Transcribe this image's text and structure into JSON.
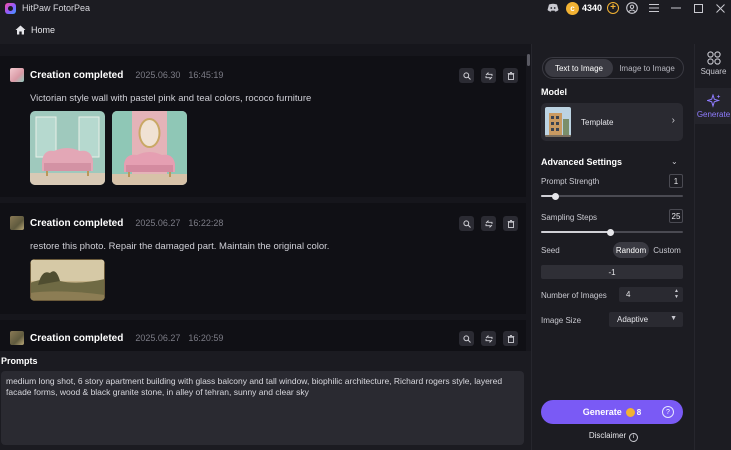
{
  "app": {
    "title": "HitPaw FotorPea"
  },
  "titlebar": {
    "coins": "4340",
    "coin_symbol": "c"
  },
  "home": {
    "label": "Home"
  },
  "feed": {
    "items": [
      {
        "title": "Creation completed",
        "date": "2025.06.30",
        "time": "16:45:19",
        "prompt": "Victorian style wall with pastel pink and teal colors, rococo furniture"
      },
      {
        "title": "Creation completed",
        "date": "2025.06.27",
        "time": "16:22:28",
        "prompt": "restore this photo. Repair the damaged part. Maintain the original color."
      },
      {
        "title": "Creation completed",
        "date": "2025.06.27",
        "time": "16:20:59"
      }
    ]
  },
  "prompts": {
    "label": "Prompts",
    "value": "medium long shot, 6 story apartment building with glass balcony and tall window, biophilic architecture, Richard rogers style, layered facade forms, wood & black granite stone, in alley of tehran, sunny and clear sky"
  },
  "panel": {
    "tabs": [
      "Text to Image",
      "Image to Image"
    ],
    "active_tab": "Text to Image",
    "model": {
      "heading": "Model",
      "name": "Template"
    },
    "advanced": {
      "heading": "Advanced Settings"
    },
    "prompt_strength": {
      "label": "Prompt Strength",
      "value": "1",
      "fraction": 0.1
    },
    "sampling_steps": {
      "label": "Sampling Steps",
      "value": "25",
      "fraction": 0.49
    },
    "seed": {
      "label": "Seed",
      "options": [
        "Random",
        "Custom"
      ],
      "selected": "Random",
      "value": "-1"
    },
    "num_images": {
      "label": "Number of Images",
      "value": "4"
    },
    "image_size": {
      "label": "Image Size",
      "value": "Adaptive"
    },
    "generate": {
      "label": "Generate",
      "cost": "8"
    },
    "disclaimer": "Disclaimer"
  },
  "nav": {
    "items": [
      {
        "label": "Square",
        "icon": "square-grid-icon"
      },
      {
        "label": "Generate",
        "icon": "sparkle-icon"
      }
    ],
    "active": "Generate"
  },
  "colors": {
    "accent": "#7a5af5",
    "coin": "#f2b233",
    "bg": "#16161c"
  }
}
